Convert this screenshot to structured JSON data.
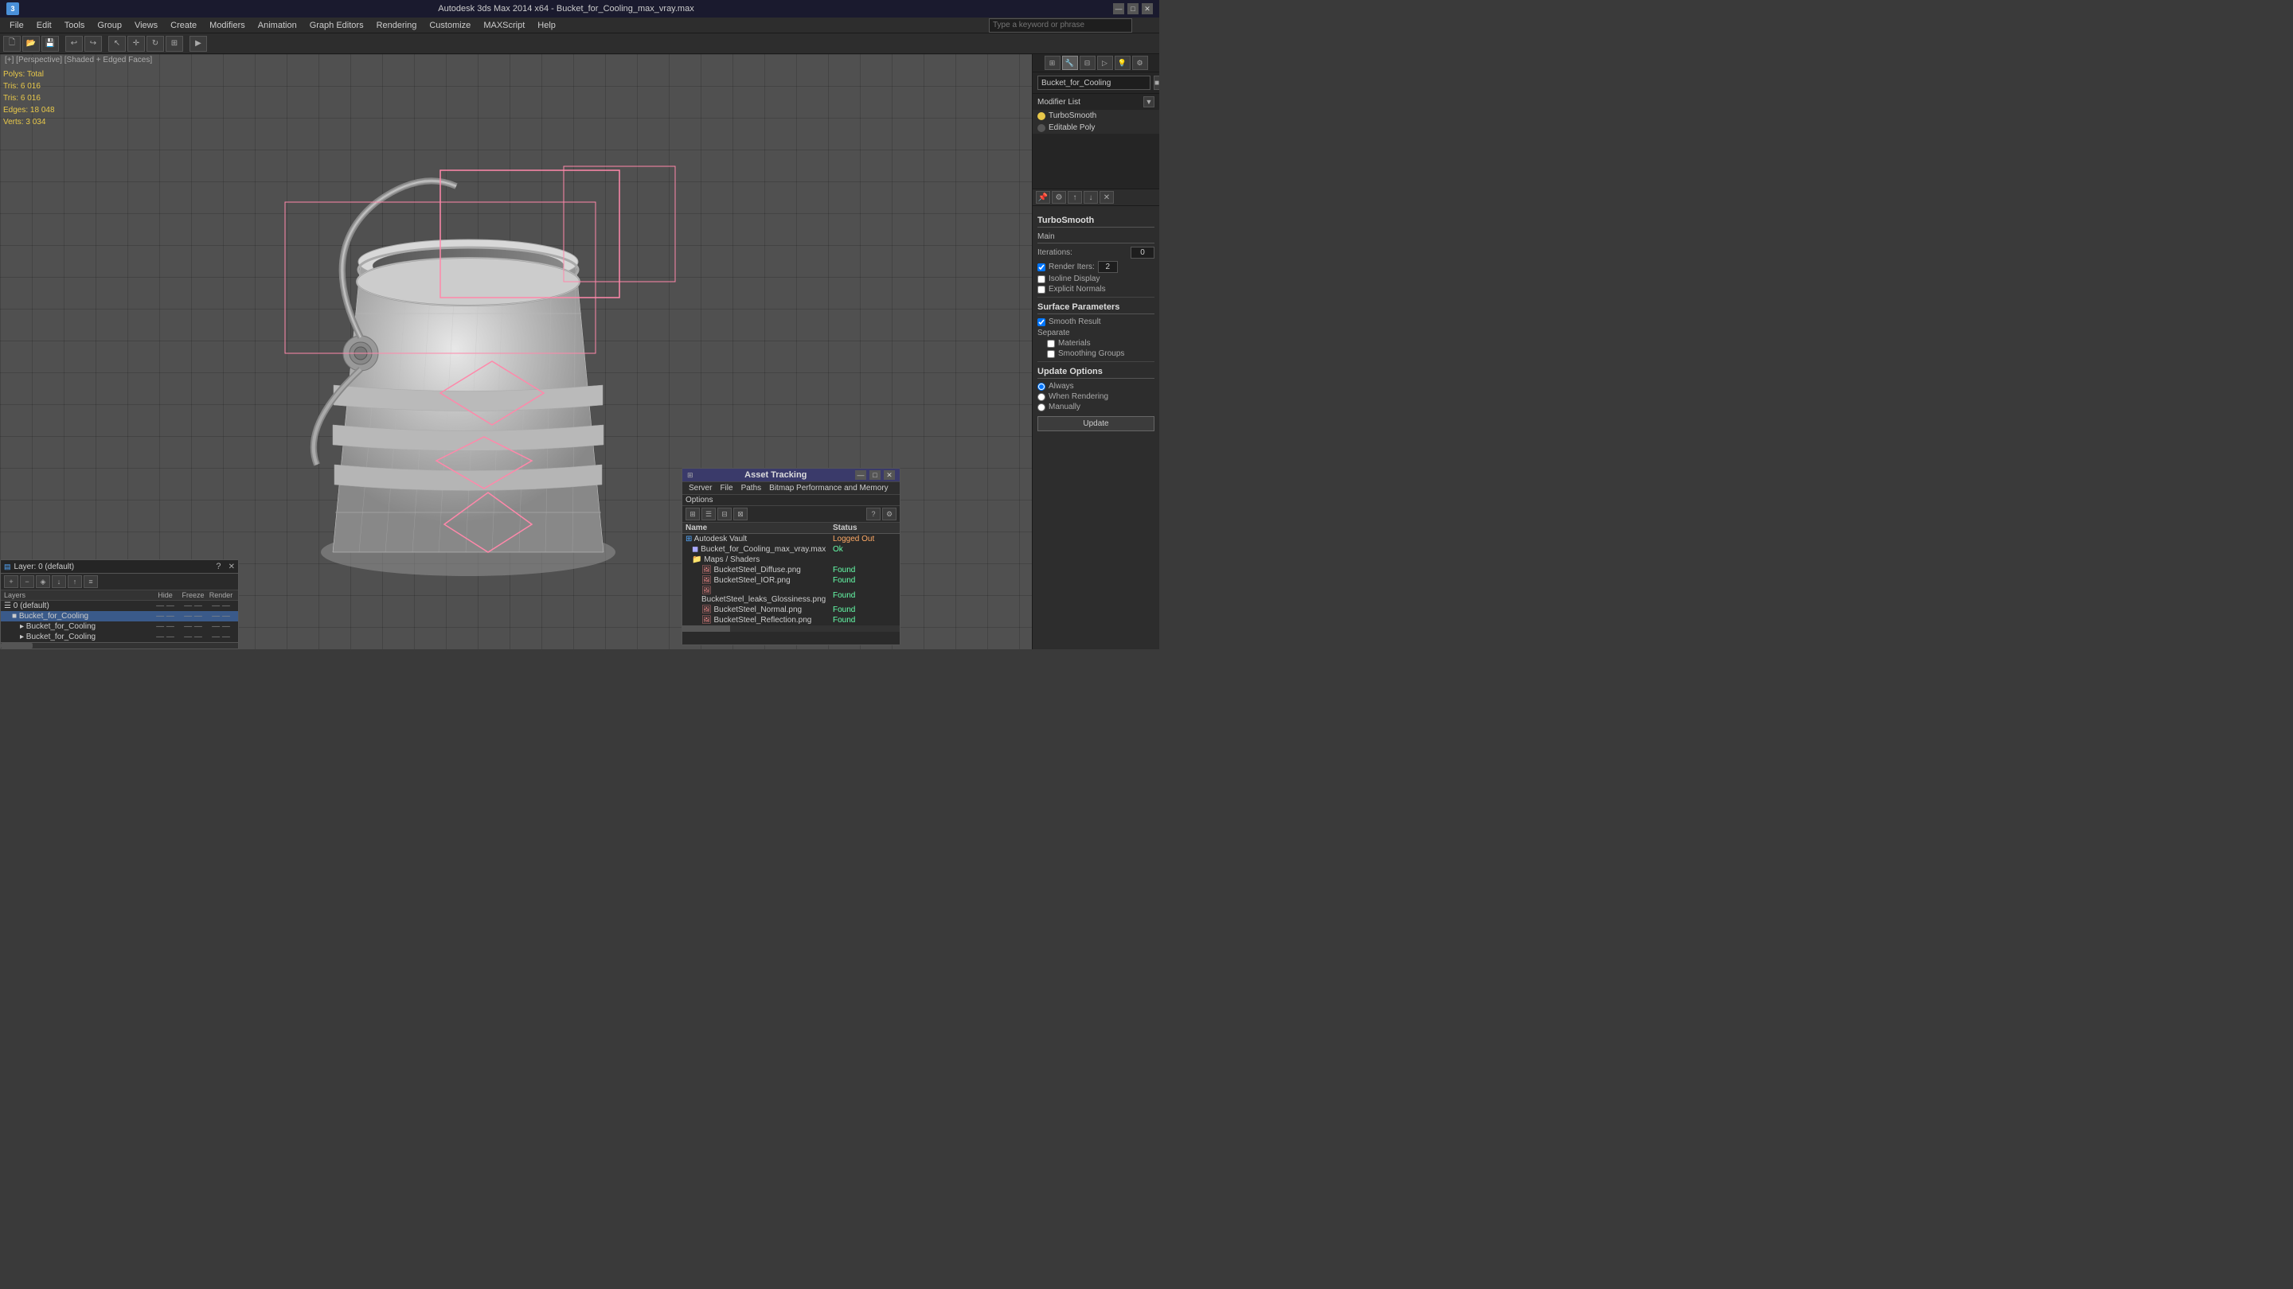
{
  "titleBar": {
    "title": "Autodesk 3ds Max 2014 x64 - Bucket_for_Cooling_max_vray.max",
    "minimize": "—",
    "maximize": "□",
    "close": "✕"
  },
  "menuBar": {
    "items": [
      {
        "id": "file",
        "label": "File"
      },
      {
        "id": "edit",
        "label": "Edit"
      },
      {
        "id": "tools",
        "label": "Tools"
      },
      {
        "id": "group",
        "label": "Group"
      },
      {
        "id": "views",
        "label": "Views"
      },
      {
        "id": "create",
        "label": "Create"
      },
      {
        "id": "modifiers",
        "label": "Modifiers"
      },
      {
        "id": "animation",
        "label": "Animation"
      },
      {
        "id": "graphEditors",
        "label": "Graph Editors"
      },
      {
        "id": "rendering",
        "label": "Rendering"
      },
      {
        "id": "customize",
        "label": "Customize"
      },
      {
        "id": "maxScript",
        "label": "MAXScript"
      },
      {
        "id": "help",
        "label": "Help"
      }
    ]
  },
  "search": {
    "placeholder": "Type a keyword or phrase"
  },
  "viewport": {
    "label": "[+] [Perspective] [Shaded + Edged Faces]",
    "stats": {
      "polys": {
        "label": "Polys:",
        "value": "Total"
      },
      "polysVal": "6 016",
      "tris": {
        "label": "Tris:",
        "value": "6 016"
      },
      "edges": {
        "label": "Edges:",
        "value": "18 048"
      },
      "verts": {
        "label": "Verts:",
        "value": "3 034"
      }
    }
  },
  "rightPanel": {
    "objectName": "Bucket_for_Cooling",
    "modifierListLabel": "Modifier List",
    "modifiers": [
      {
        "name": "TurboSmooth",
        "active": true,
        "selected": false
      },
      {
        "name": "Editable Poly",
        "active": true,
        "selected": false
      }
    ],
    "turboSmooth": {
      "title": "TurboSmooth",
      "mainSection": "Main",
      "iterations": {
        "label": "Iterations:",
        "value": "0"
      },
      "renderIters": {
        "label": "Render Iters:",
        "value": "2"
      },
      "isoline": {
        "label": "Isoline Display",
        "checked": false
      },
      "explicitNormals": {
        "label": "Explicit Normals",
        "checked": false
      },
      "surfaceParams": {
        "title": "Surface Parameters"
      },
      "smoothResult": {
        "label": "Smooth Result",
        "checked": true
      },
      "separate": {
        "label": "Separate"
      },
      "materials": {
        "label": "Materials",
        "checked": false
      },
      "smoothingGroups": {
        "label": "Smoothing Groups",
        "checked": false
      },
      "updateOptions": {
        "title": "Update Options"
      },
      "always": {
        "label": "Always",
        "checked": true
      },
      "whenRendering": {
        "label": "When Rendering",
        "checked": false
      },
      "manually": {
        "label": "Manually",
        "checked": false
      },
      "updateBtn": "Update"
    }
  },
  "layerPanel": {
    "title": "Layer: 0 (default)",
    "closeBtn": "✕",
    "helpBtn": "?",
    "columns": {
      "name": "Layers",
      "hide": "Hide",
      "freeze": "Freeze",
      "render": "Render"
    },
    "rows": [
      {
        "name": "0 (default)",
        "indent": 0,
        "selected": false
      },
      {
        "name": "Bucket_for_Cooling",
        "indent": 1,
        "selected": true
      },
      {
        "name": "Bucket_for_Cooling",
        "indent": 2,
        "selected": false
      },
      {
        "name": "Bucket_for_Cooling",
        "indent": 2,
        "selected": false
      }
    ]
  },
  "assetTracking": {
    "title": "Asset Tracking",
    "menu": [
      {
        "label": "Server"
      },
      {
        "label": "File"
      },
      {
        "label": "Paths"
      },
      {
        "label": "Bitmap Performance and Memory"
      },
      {
        "label": "Options"
      }
    ],
    "columns": {
      "name": "Name",
      "status": "Status"
    },
    "rows": [
      {
        "name": "Autodesk Vault",
        "status": "Logged Out",
        "indent": 0,
        "icon": "vault"
      },
      {
        "name": "Bucket_for_Cooling_max_vray.max",
        "status": "Ok",
        "indent": 1,
        "icon": "file"
      },
      {
        "name": "Maps / Shaders",
        "status": "",
        "indent": 1,
        "icon": "folder"
      },
      {
        "name": "BucketSteel_Diffuse.png",
        "status": "Found",
        "indent": 2,
        "icon": "bitmap"
      },
      {
        "name": "BucketSteel_IOR.png",
        "status": "Found",
        "indent": 2,
        "icon": "bitmap"
      },
      {
        "name": "BucketSteel_leaks_Glossiness.png",
        "status": "Found",
        "indent": 2,
        "icon": "bitmap"
      },
      {
        "name": "BucketSteel_Normal.png",
        "status": "Found",
        "indent": 2,
        "icon": "bitmap"
      },
      {
        "name": "BucketSteel_Reflection.png",
        "status": "Found",
        "indent": 2,
        "icon": "bitmap"
      }
    ]
  }
}
